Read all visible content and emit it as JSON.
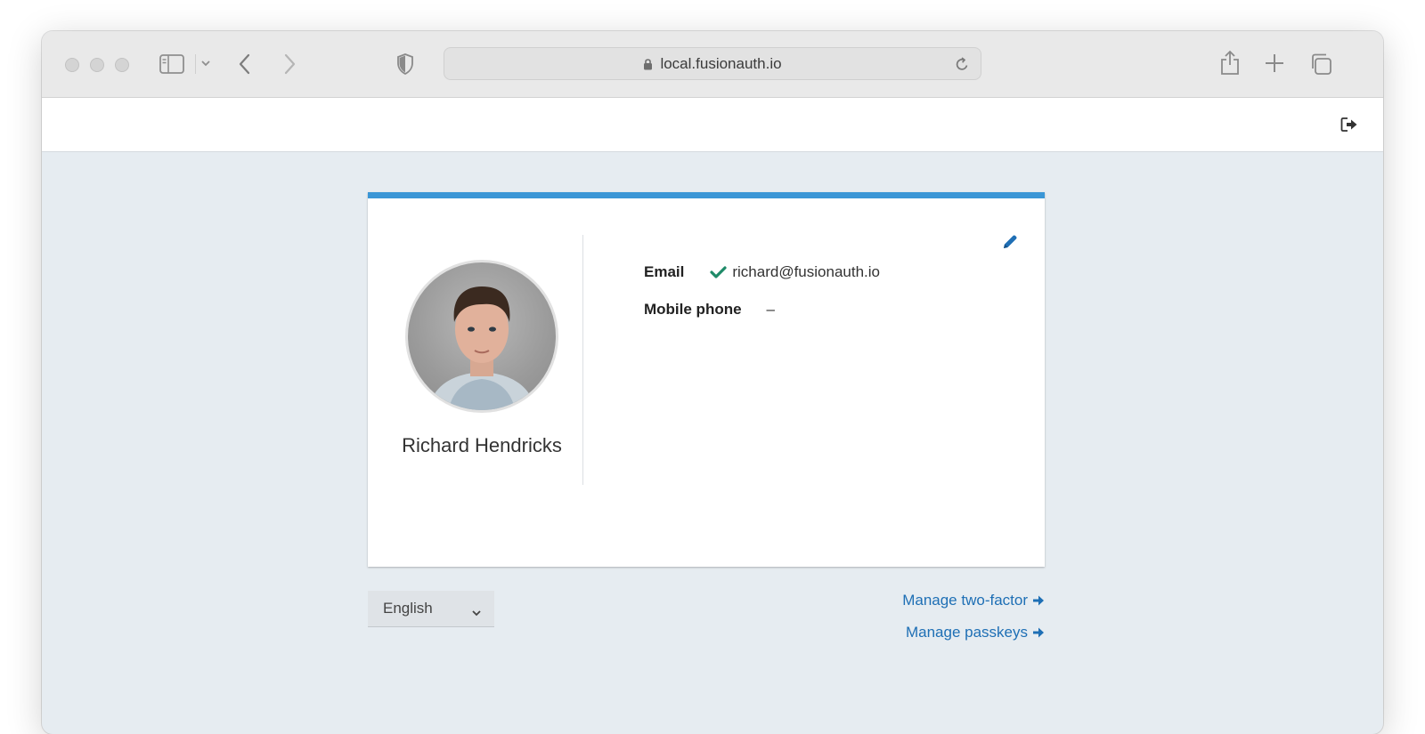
{
  "browser": {
    "url": "local.fusionauth.io"
  },
  "profile": {
    "name": "Richard Hendricks",
    "email_label": "Email",
    "email_value": "richard@fusionauth.io",
    "email_verified": true,
    "phone_label": "Mobile phone",
    "phone_value": "–"
  },
  "footer": {
    "language": "English",
    "manage_two_factor": "Manage two-factor",
    "manage_passkeys": "Manage passkeys"
  },
  "colors": {
    "accent": "#3a96d6",
    "link": "#1e6fb5",
    "verified": "#1e8a68",
    "background": "#e6ecf1"
  },
  "icons": [
    "traffic-light",
    "sidebar-icon",
    "back-icon",
    "forward-icon",
    "shield-icon",
    "lock-icon",
    "reload-icon",
    "share-icon",
    "new-tab-icon",
    "tabs-icon",
    "logout-icon",
    "edit-icon",
    "check-icon",
    "chevron-down-icon",
    "arrow-right-icon"
  ]
}
